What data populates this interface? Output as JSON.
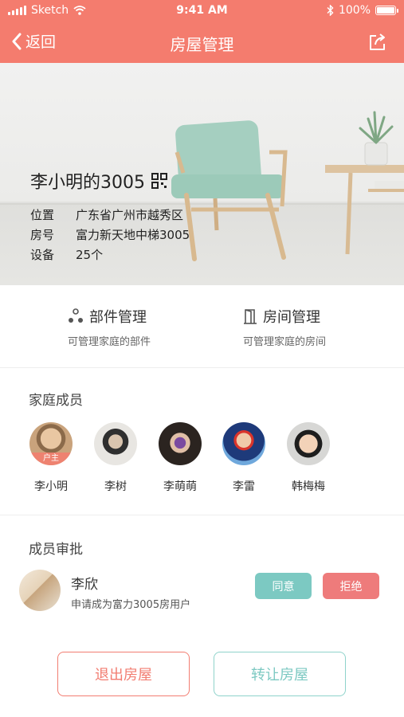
{
  "status_bar": {
    "carrier": "Sketch",
    "time": "9:41 AM",
    "battery": "100%"
  },
  "nav": {
    "back_label": "返回",
    "title": "房屋管理"
  },
  "house": {
    "name": "李小明的3005",
    "rows": [
      {
        "key": "位置",
        "value": "广东省广州市越秀区"
      },
      {
        "key": "房号",
        "value": "富力新天地中梯3005"
      },
      {
        "key": "设备",
        "value": "25个"
      }
    ]
  },
  "management": [
    {
      "title": "部件管理",
      "subtitle": "可管理家庭的部件",
      "icon": "parts-icon"
    },
    {
      "title": "房间管理",
      "subtitle": "可管理家庭的房间",
      "icon": "room-door-icon"
    }
  ],
  "family": {
    "title": "家庭成员",
    "owner_tag": "户主",
    "members": [
      {
        "name": "李小明"
      },
      {
        "name": "李树"
      },
      {
        "name": "李萌萌"
      },
      {
        "name": "李雷"
      },
      {
        "name": "韩梅梅"
      }
    ]
  },
  "approval": {
    "title": "成员审批",
    "request": {
      "name": "李欣",
      "description": "申请成为富力3005房用户"
    },
    "agree_label": "同意",
    "reject_label": "拒绝"
  },
  "actions": {
    "exit_label": "退出房屋",
    "transfer_label": "转让房屋"
  },
  "colors": {
    "primary": "#F47C6E",
    "accent_teal": "#7CC9C2",
    "reject": "#EE7B7B"
  }
}
